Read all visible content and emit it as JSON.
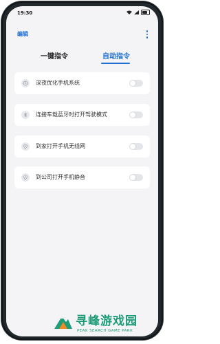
{
  "status_bar": {
    "time": "19:30"
  },
  "header": {
    "edit_label": "编辑"
  },
  "tabs": [
    {
      "label": "一键指令"
    },
    {
      "label": "自动指令"
    }
  ],
  "cards": [
    {
      "label": "深夜优化手机系统",
      "icon": "clock-icon",
      "enabled": false
    },
    {
      "label": "连接车载蓝牙时打开驾驶模式",
      "icon": "bluetooth-icon",
      "enabled": false
    },
    {
      "label": "到家打开手机无线网",
      "icon": "location-icon",
      "enabled": false
    },
    {
      "label": "到公司打开手机静音",
      "icon": "location-icon",
      "enabled": false
    }
  ],
  "watermark": {
    "title": "寻峰游戏园",
    "subtitle": "PEAK SEARCH GAME PARK"
  },
  "colors": {
    "accent": "#1f6fd1",
    "brand": "#1f9c78"
  }
}
